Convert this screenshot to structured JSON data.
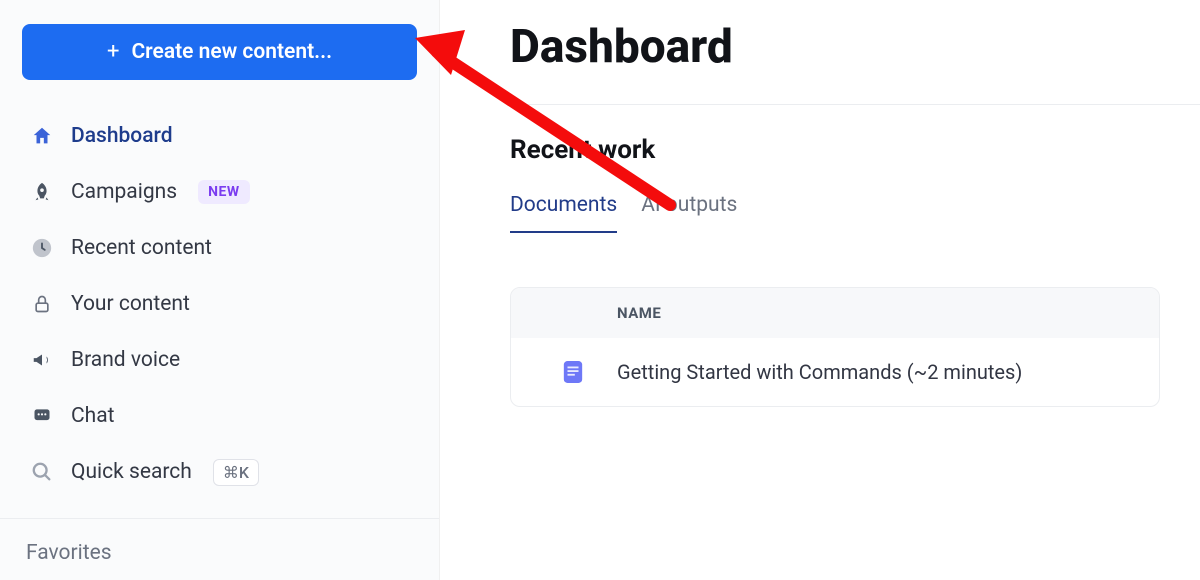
{
  "sidebar": {
    "create_label": "Create new content...",
    "items": [
      {
        "label": "Dashboard",
        "icon": "home-icon",
        "active": true
      },
      {
        "label": "Campaigns",
        "icon": "rocket-icon",
        "badge": "NEW"
      },
      {
        "label": "Recent content",
        "icon": "clock-icon"
      },
      {
        "label": "Your content",
        "icon": "lock-icon"
      },
      {
        "label": "Brand voice",
        "icon": "megaphone-icon"
      },
      {
        "label": "Chat",
        "icon": "chat-icon"
      },
      {
        "label": "Quick search",
        "icon": "search-icon",
        "shortcut": "⌘K"
      }
    ],
    "favorites_label": "Favorites"
  },
  "main": {
    "title": "Dashboard",
    "recent_title": "Recent work",
    "tabs": [
      {
        "label": "Documents",
        "active": true
      },
      {
        "label": "AI outputs"
      }
    ],
    "table": {
      "header": "NAME",
      "rows": [
        {
          "name": "Getting Started with Commands (~2 minutes)"
        }
      ]
    }
  }
}
